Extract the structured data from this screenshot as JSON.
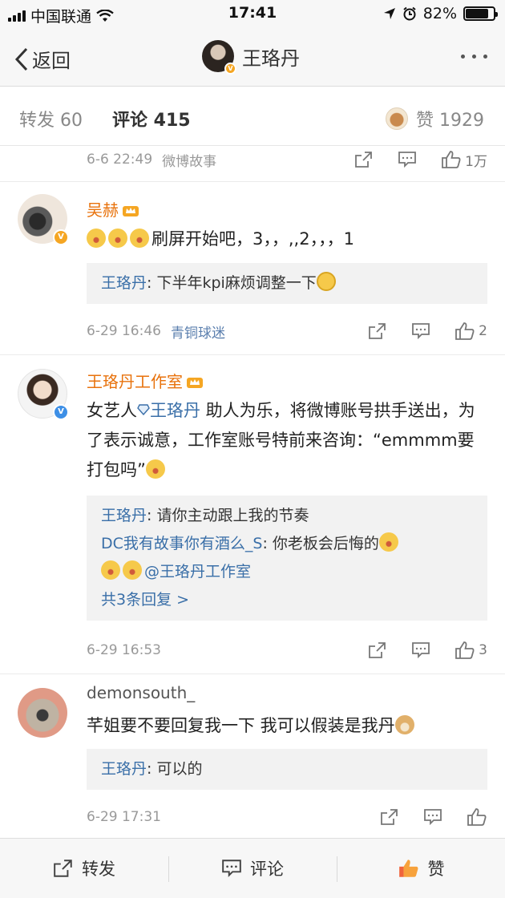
{
  "status_bar": {
    "carrier": "中国联通",
    "time": "17:41",
    "battery_percent": "82%",
    "battery_level": 0.82
  },
  "nav": {
    "back_label": "返回",
    "title": "王珞丹"
  },
  "tabs": {
    "repost": "转发 60",
    "comment": "评论 415",
    "like": "赞 1929"
  },
  "prev_item": {
    "time": "6-6 22:49",
    "source": "微博故事",
    "like_count": "1万"
  },
  "comments": [
    {
      "name": "吴赫",
      "text": "刷屏开始吧，3，，,,2，，，1",
      "replies": [
        {
          "author": "王珞丹",
          "text": ": 下半年kpi麻烦调整一下"
        }
      ],
      "time": "6-29 16:46",
      "source": "青铜球迷",
      "like_count": "2"
    },
    {
      "name": "王珞丹工作室",
      "text_a": "女艺人",
      "mention": "王珞丹",
      "text_b": " 助人为乐，将微博账号拱手送出，为了表示诚意，工作室账号特前来咨询：“emmmm要打包吗”",
      "replies": [
        {
          "author": "王珞丹",
          "text": ": 请你主动跟上我的节奏"
        },
        {
          "author": "DC我有故事你有酒么_S",
          "text": ": 你老板会后悔的"
        },
        {
          "text": "@王珞丹工作室"
        }
      ],
      "more_replies": "共3条回复 >",
      "time": "6-29 16:53",
      "like_count": "3"
    },
    {
      "name": "demonsouth_",
      "text": "芊姐要不要回复我一下 我可以假装是我丹",
      "replies": [
        {
          "author": "王珞丹",
          "text": ": 可以的"
        }
      ],
      "time": "6-29 17:31"
    }
  ],
  "toolbar": {
    "repost": "转发",
    "comment": "评论",
    "like": "赞"
  },
  "colors": {
    "accent_orange": "#e8720c",
    "link_blue": "#3a6fa8",
    "like_red": "#f0643c"
  }
}
